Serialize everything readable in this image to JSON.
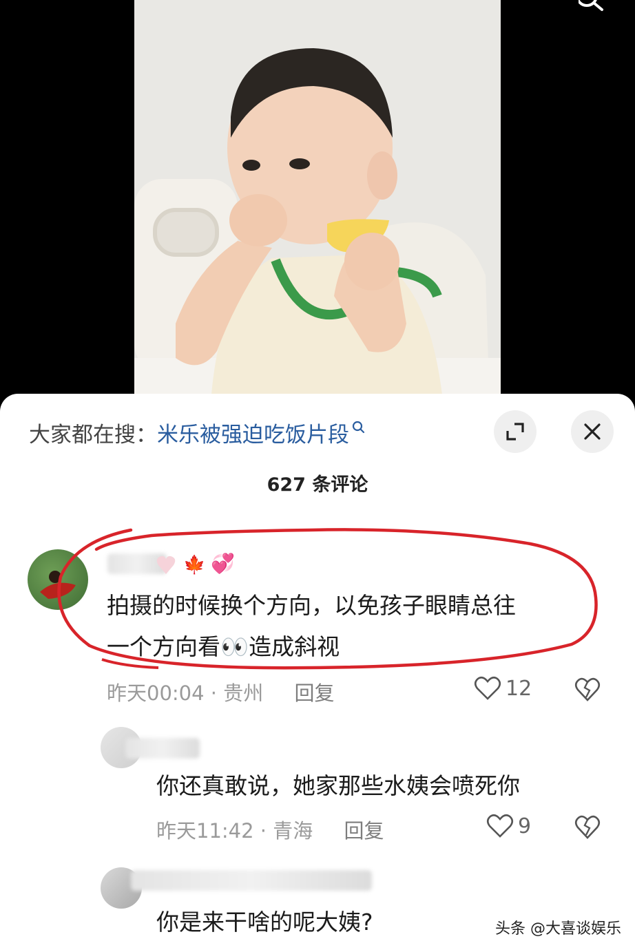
{
  "video": {
    "thumbnail_icon": "child-eating-photo"
  },
  "sheet": {
    "search_prefix": "大家都在搜：",
    "search_query": "米乐被强迫吃饭片段",
    "comment_count": "627 条评论"
  },
  "comments": [
    {
      "text_line1": "拍摄的时候换个方向，以免孩子眼睛总往",
      "text_line2": "一个方向看👀造成斜视",
      "time": "昨天00:04",
      "sep": "·",
      "location": "贵州",
      "reply": "回复",
      "likes": "12"
    },
    {
      "text": "你还真敢说，她家那些水姨会喷死你",
      "time": "昨天11:42",
      "sep": "·",
      "location": "青海",
      "reply": "回复",
      "likes": "9"
    },
    {
      "text": "你是来干啥的呢大姨?"
    }
  ],
  "watermark": "头条 @大喜谈娱乐",
  "colors": {
    "link": "#2a5d9f",
    "annotation": "#d8242a"
  }
}
